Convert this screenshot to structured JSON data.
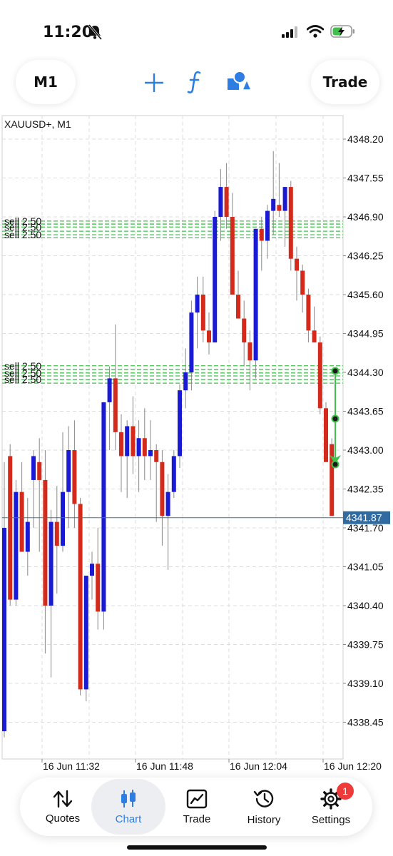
{
  "status_bar": {
    "time": "11:20"
  },
  "toolbar": {
    "timeframe": "M1",
    "trade_label": "Trade",
    "crosshair_icon": "crosshair-icon",
    "function_icon": "function-icon",
    "objects_icon": "shapes-icon"
  },
  "chart": {
    "symbol_label": "XAUUSD+, M1",
    "price_ticks": [
      "4348.20",
      "4347.55",
      "4346.90",
      "4346.25",
      "4345.60",
      "4344.95",
      "4344.30",
      "4343.65",
      "4343.00",
      "4342.35",
      "4341.70",
      "4341.05",
      "4340.40",
      "4339.75",
      "4339.10",
      "4338.45"
    ],
    "time_ticks": [
      "16 Jun 11:32",
      "16 Jun 11:48",
      "16 Jun 12:04",
      "16 Jun 12:20"
    ],
    "current_price": "4341.87",
    "order_label": "sell 2.50",
    "colors": {
      "bull": "#1a1ad4",
      "bear": "#d42a1c",
      "order_line": "#3fc24a",
      "price_line": "#4a6e8c",
      "grid": "#dcdcdc"
    }
  },
  "chart_data": {
    "type": "candlestick",
    "title": "XAUUSD+, M1",
    "y_range": [
      4337.9,
      4348.7
    ],
    "x_range": [
      "16 Jun 11:20",
      "16 Jun 12:20"
    ],
    "candles": [
      {
        "o": 4338.3,
        "h": 4342.8,
        "l": 4338.2,
        "c": 4341.7
      },
      {
        "o": 4342.9,
        "h": 4343.1,
        "l": 4340.4,
        "c": 4340.5
      },
      {
        "o": 4340.5,
        "h": 4342.5,
        "l": 4340.4,
        "c": 4342.3
      },
      {
        "o": 4342.3,
        "h": 4342.8,
        "l": 4341.3,
        "c": 4341.3
      },
      {
        "o": 4341.3,
        "h": 4342.2,
        "l": 4340.9,
        "c": 4341.8
      },
      {
        "o": 4342.5,
        "h": 4343.0,
        "l": 4341.7,
        "c": 4342.9
      },
      {
        "o": 4342.8,
        "h": 4343.2,
        "l": 4341.3,
        "c": 4342.5
      },
      {
        "o": 4342.5,
        "h": 4343.0,
        "l": 4339.6,
        "c": 4340.4
      },
      {
        "o": 4340.4,
        "h": 4342.0,
        "l": 4339.2,
        "c": 4341.8
      },
      {
        "o": 4341.8,
        "h": 4342.4,
        "l": 4340.6,
        "c": 4341.4
      },
      {
        "o": 4341.4,
        "h": 4343.3,
        "l": 4341.3,
        "c": 4342.3
      },
      {
        "o": 4342.3,
        "h": 4343.4,
        "l": 4341.7,
        "c": 4343.0
      },
      {
        "o": 4343.0,
        "h": 4343.5,
        "l": 4341.7,
        "c": 4342.1
      },
      {
        "o": 4342.1,
        "h": 4342.2,
        "l": 4338.9,
        "c": 4339.0
      },
      {
        "o": 4339.0,
        "h": 4340.9,
        "l": 4338.8,
        "c": 4340.9
      },
      {
        "o": 4340.9,
        "h": 4341.3,
        "l": 4340.5,
        "c": 4341.1
      },
      {
        "o": 4341.1,
        "h": 4341.7,
        "l": 4340.0,
        "c": 4340.3
      },
      {
        "o": 4340.3,
        "h": 4343.8,
        "l": 4340.0,
        "c": 4343.8
      },
      {
        "o": 4343.8,
        "h": 4344.4,
        "l": 4343.0,
        "c": 4344.2
      },
      {
        "o": 4344.2,
        "h": 4345.1,
        "l": 4343.0,
        "c": 4343.3
      },
      {
        "o": 4343.3,
        "h": 4343.6,
        "l": 4342.3,
        "c": 4342.9
      },
      {
        "o": 4342.9,
        "h": 4343.5,
        "l": 4342.2,
        "c": 4343.4
      },
      {
        "o": 4343.4,
        "h": 4343.9,
        "l": 4342.6,
        "c": 4342.9
      },
      {
        "o": 4342.9,
        "h": 4343.5,
        "l": 4342.3,
        "c": 4343.2
      },
      {
        "o": 4343.2,
        "h": 4343.7,
        "l": 4342.5,
        "c": 4342.9
      },
      {
        "o": 4342.9,
        "h": 4343.5,
        "l": 4342.5,
        "c": 4343.0
      },
      {
        "o": 4343.0,
        "h": 4343.1,
        "l": 4341.8,
        "c": 4342.8
      },
      {
        "o": 4342.8,
        "h": 4343.0,
        "l": 4341.4,
        "c": 4341.9
      },
      {
        "o": 4341.9,
        "h": 4342.6,
        "l": 4341.0,
        "c": 4342.3
      },
      {
        "o": 4342.3,
        "h": 4343.0,
        "l": 4342.2,
        "c": 4342.9
      },
      {
        "o": 4342.9,
        "h": 4344.1,
        "l": 4342.7,
        "c": 4344.0
      },
      {
        "o": 4344.0,
        "h": 4344.7,
        "l": 4343.7,
        "c": 4344.3
      },
      {
        "o": 4344.3,
        "h": 4345.5,
        "l": 4344.0,
        "c": 4345.3
      },
      {
        "o": 4345.3,
        "h": 4345.9,
        "l": 4344.7,
        "c": 4345.6
      },
      {
        "o": 4345.6,
        "h": 4345.9,
        "l": 4344.8,
        "c": 4345.0
      },
      {
        "o": 4345.0,
        "h": 4345.3,
        "l": 4344.6,
        "c": 4344.8
      },
      {
        "o": 4344.8,
        "h": 4347.0,
        "l": 4344.8,
        "c": 4346.9
      },
      {
        "o": 4346.9,
        "h": 4347.7,
        "l": 4346.5,
        "c": 4347.4
      },
      {
        "o": 4347.4,
        "h": 4347.8,
        "l": 4346.7,
        "c": 4346.9
      },
      {
        "o": 4346.9,
        "h": 4347.3,
        "l": 4345.7,
        "c": 4345.6
      },
      {
        "o": 4345.6,
        "h": 4346.0,
        "l": 4345.2,
        "c": 4345.2
      },
      {
        "o": 4345.2,
        "h": 4345.5,
        "l": 4344.4,
        "c": 4344.8
      },
      {
        "o": 4344.8,
        "h": 4345.0,
        "l": 4344.0,
        "c": 4344.5
      },
      {
        "o": 4344.5,
        "h": 4346.7,
        "l": 4344.2,
        "c": 4346.7
      },
      {
        "o": 4346.7,
        "h": 4346.9,
        "l": 4346.0,
        "c": 4346.5
      },
      {
        "o": 4346.5,
        "h": 4347.1,
        "l": 4346.2,
        "c": 4347.0
      },
      {
        "o": 4347.0,
        "h": 4348.0,
        "l": 4346.6,
        "c": 4347.2
      },
      {
        "o": 4347.1,
        "h": 4347.8,
        "l": 4346.9,
        "c": 4347.0
      },
      {
        "o": 4347.0,
        "h": 4347.4,
        "l": 4346.4,
        "c": 4347.4
      },
      {
        "o": 4347.4,
        "h": 4347.5,
        "l": 4346.0,
        "c": 4346.2
      },
      {
        "o": 4346.2,
        "h": 4346.4,
        "l": 4345.5,
        "c": 4346.0
      },
      {
        "o": 4346.0,
        "h": 4346.1,
        "l": 4345.3,
        "c": 4345.6
      },
      {
        "o": 4345.6,
        "h": 4345.7,
        "l": 4344.8,
        "c": 4345.0
      },
      {
        "o": 4345.0,
        "h": 4345.4,
        "l": 4344.8,
        "c": 4344.8
      },
      {
        "o": 4344.8,
        "h": 4344.9,
        "l": 4343.6,
        "c": 4343.7
      },
      {
        "o": 4343.7,
        "h": 4343.8,
        "l": 4342.8,
        "c": 4342.8
      },
      {
        "o": 4343.1,
        "h": 4343.2,
        "l": 4341.9,
        "c": 4341.9
      }
    ],
    "order_levels": [
      4346.83,
      4346.78,
      4346.73,
      4346.66,
      4346.6,
      4346.55,
      4344.41,
      4344.35,
      4344.29,
      4344.24,
      4344.18,
      4344.12
    ],
    "current_price": 4341.87
  },
  "tabs": [
    {
      "label": "Quotes",
      "icon": "quotes-icon"
    },
    {
      "label": "Chart",
      "icon": "chart-icon"
    },
    {
      "label": "Trade",
      "icon": "trade-icon"
    },
    {
      "label": "History",
      "icon": "history-icon"
    },
    {
      "label": "Settings",
      "icon": "settings-icon"
    }
  ],
  "settings_badge": "1"
}
